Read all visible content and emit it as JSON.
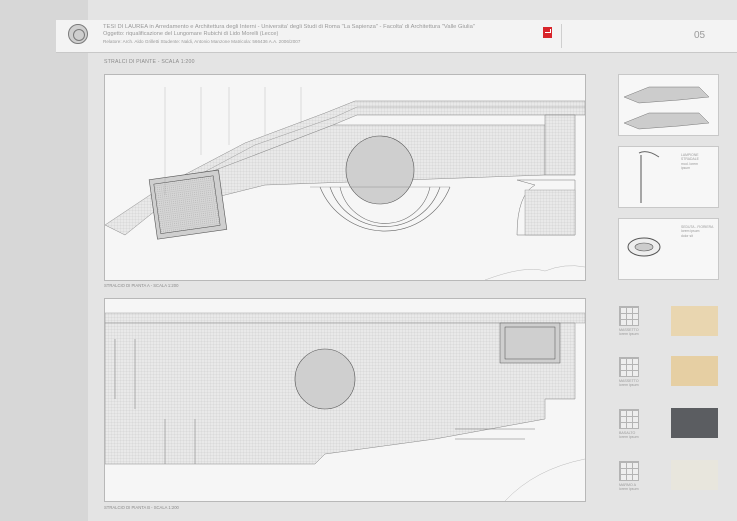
{
  "header": {
    "line1": "TESI DI LAUREA  in Arredamento e Architettura degli Interni - Universita' degli Studi di Roma \"La Sapienza\" - Facolta' di Architettura \"Valle Giulia\"",
    "line2": "Oggetto: riqualificazione del Lungomare Rubichi di Lido Morelli (Lecce)",
    "line3": "Relatore: Arch. Aldo Grilletti     Studente: Naldi, Antonio Manzone     Matricola: 566436    A.A. 2006/2007",
    "page_number": "05"
  },
  "section_title": "STRALCI DI PIANTE - SCALA 1:200",
  "plans": {
    "caption_a": "STRALCIO DI PIANTA  A - SCALA 1:200",
    "caption_b": "STRALCIO DI PIANTA  B - SCALA 1:200"
  },
  "thumbs": {
    "lamp_text": "LAMPIONE\nSTRADALE\nmod. lorem\nipsum",
    "bench_text": "SEDUTA - FIORIERA\nlorem ipsum\ndolor sit"
  },
  "materials": [
    {
      "label": "MASSETTO\nlorem ipsum",
      "color": "#e9d6b0"
    },
    {
      "label": "MASSETTO\nlorem ipsum",
      "color": "#e6cfa3"
    },
    {
      "label": "BASALTO\nlorem ipsum",
      "color": "#5b5d61"
    },
    {
      "label": "MARMO A\nlorem ipsum",
      "color": "#e8e6dd"
    }
  ],
  "colors": {
    "accent": "#d8242a",
    "hatch": "#9a9a9a",
    "ink": "#555555"
  }
}
